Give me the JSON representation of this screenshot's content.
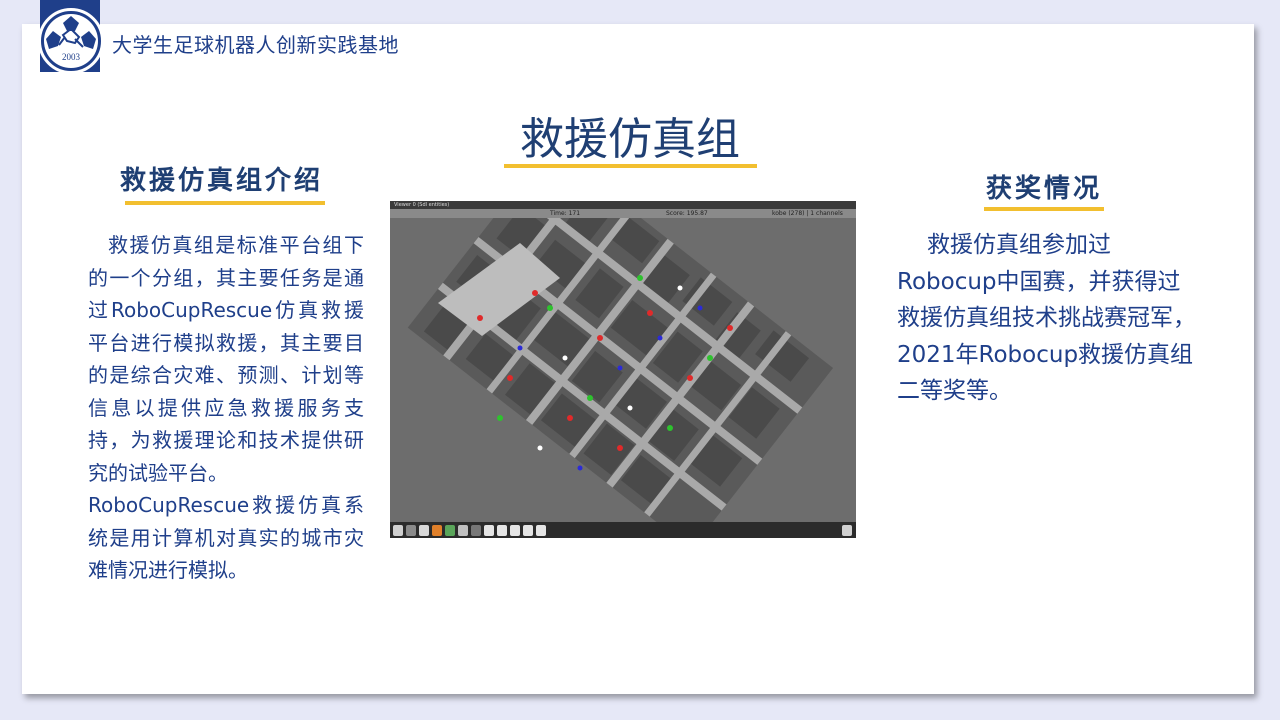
{
  "header": {
    "org_name": "大学生足球机器人创新实践基地",
    "logo_year": "2003"
  },
  "slide": {
    "title": "救援仿真组",
    "left_section": {
      "title": "救援仿真组介绍",
      "paragraphs": [
        "救援仿真组是标准平台组下的一个分组，其主要任务是通过RoboCupRescue仿真救援平台进行模拟救援，其主要目的是综合灾难、预测、计划等信息以提供应急救援服务支持，为救援理论和技术提供研究的试验平台。",
        "RoboCupRescue救援仿真系统是用计算机对真实的城市灾难情况进行模拟。"
      ]
    },
    "right_section": {
      "title": "获奖情况",
      "paragraphs": [
        "救援仿真组参加过Robocup中国赛，并获得过救援仿真组技术挑战赛冠军，2021年Robocup救援仿真组二等奖等。"
      ]
    },
    "screenshot": {
      "window_title": "Viewer 0 (Sdl entities)",
      "time": "Time: 171",
      "score": "Score: 195.87",
      "channels": "kobe (278) | 1 channels"
    }
  },
  "colors": {
    "accent": "#f2bf2f",
    "title": "#1f3f73",
    "text": "#1f3f8a",
    "background": "#e6e8f7"
  }
}
